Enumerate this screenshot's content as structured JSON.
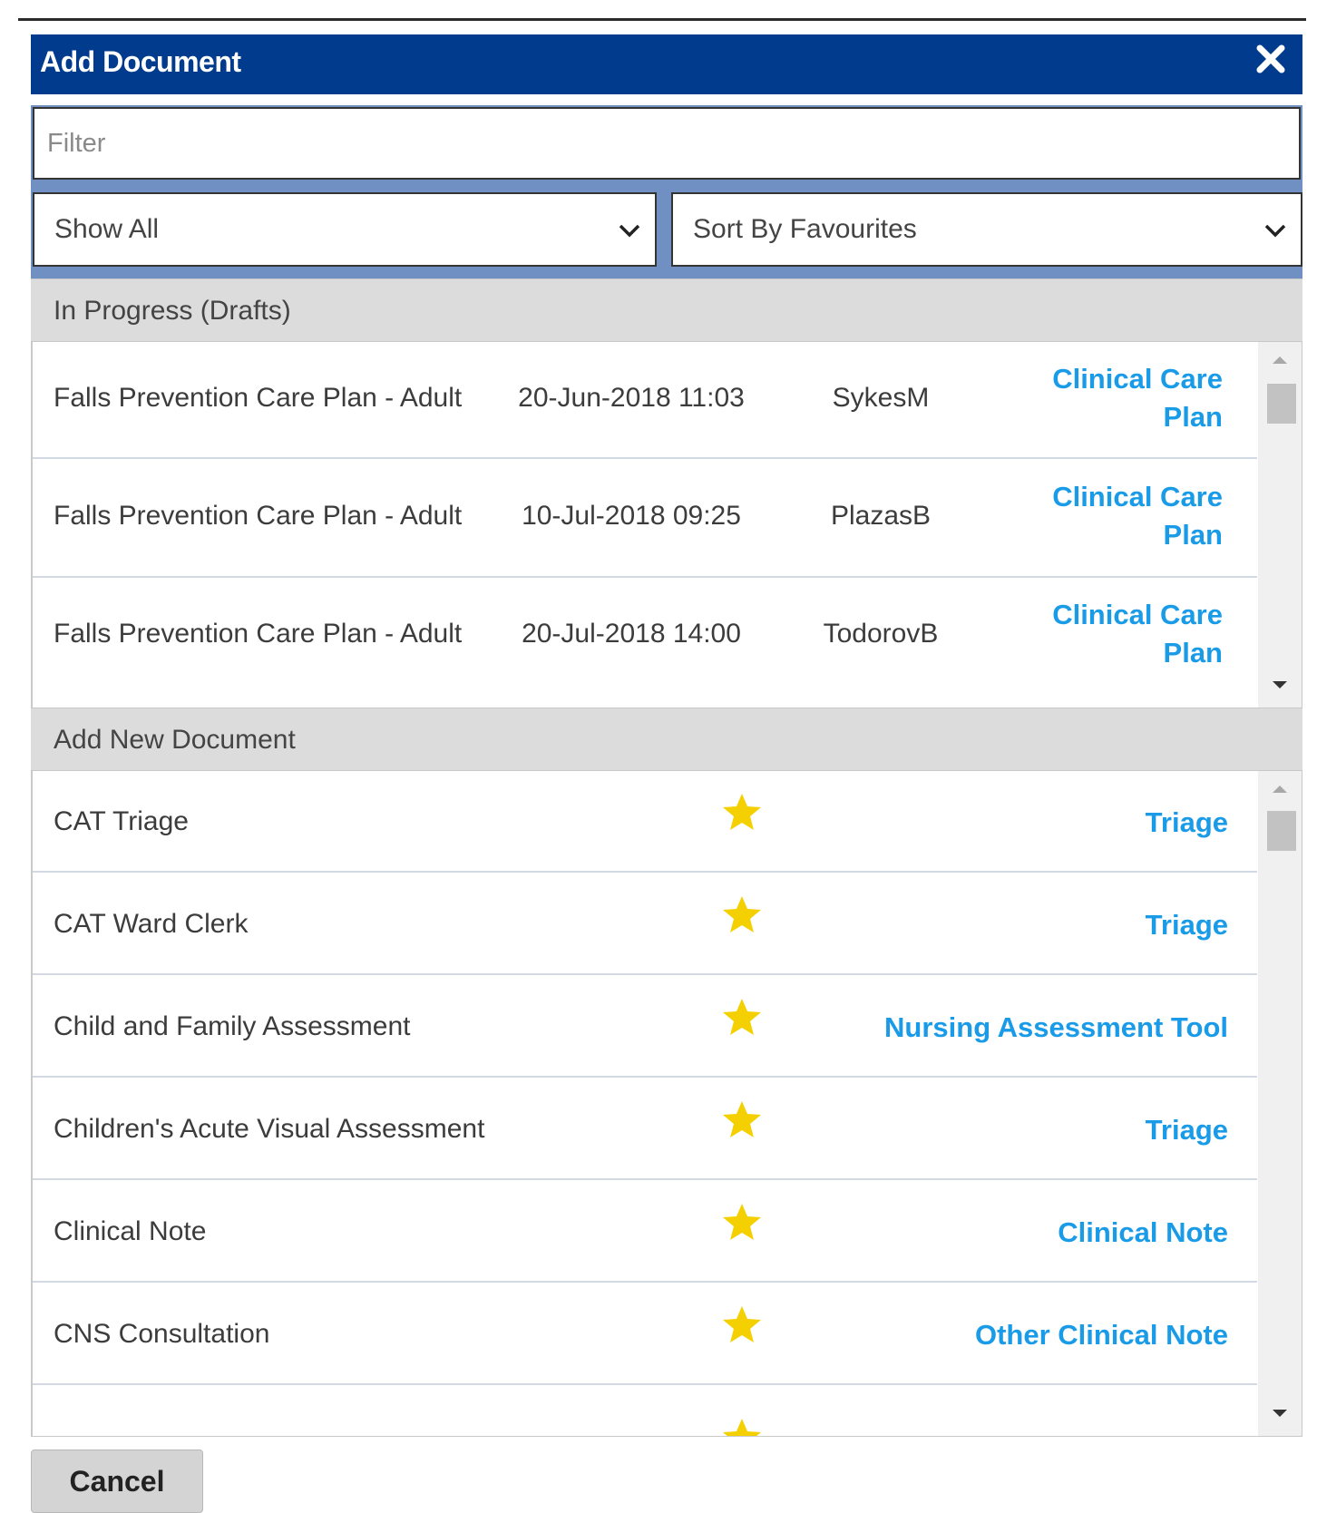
{
  "dialog": {
    "title": "Add Document",
    "close_icon": "close-icon"
  },
  "filter": {
    "placeholder": "Filter",
    "value": ""
  },
  "selects": {
    "show": "Show All",
    "sort": "Sort By Favourites"
  },
  "drafts": {
    "header": "In Progress (Drafts)",
    "rows": [
      {
        "name": "Falls Prevention Care Plan - Adult",
        "date": "20-Jun-2018 11:03",
        "user": "SykesM",
        "category_line1": "Clinical Care",
        "category_line2": "Plan"
      },
      {
        "name": "Falls Prevention Care Plan - Adult",
        "date": "10-Jul-2018 09:25",
        "user": "PlazasB",
        "category_line1": "Clinical Care",
        "category_line2": "Plan"
      },
      {
        "name": "Falls Prevention Care Plan - Adult",
        "date": "20-Jul-2018 14:00",
        "user": "TodorovB",
        "category_line1": "Clinical Care",
        "category_line2": "Plan"
      }
    ]
  },
  "new_docs": {
    "header": "Add New Document",
    "rows": [
      {
        "name": "CAT Triage",
        "favourite": true,
        "category": "Triage"
      },
      {
        "name": "CAT Ward Clerk",
        "favourite": true,
        "category": "Triage"
      },
      {
        "name": "Child and Family Assessment",
        "favourite": true,
        "category": "Nursing Assessment Tool"
      },
      {
        "name": "Children's Acute Visual Assessment",
        "favourite": true,
        "category": "Triage"
      },
      {
        "name": "Clinical Note",
        "favourite": true,
        "category": "Clinical Note"
      },
      {
        "name": "CNS Consultation",
        "favourite": true,
        "category": "Other Clinical Note"
      }
    ]
  },
  "footer": {
    "cancel_label": "Cancel"
  },
  "colors": {
    "titlebar": "#003b8e",
    "link": "#1a9be8",
    "star": "#f5d000",
    "section_header": "#dcdcdc"
  }
}
